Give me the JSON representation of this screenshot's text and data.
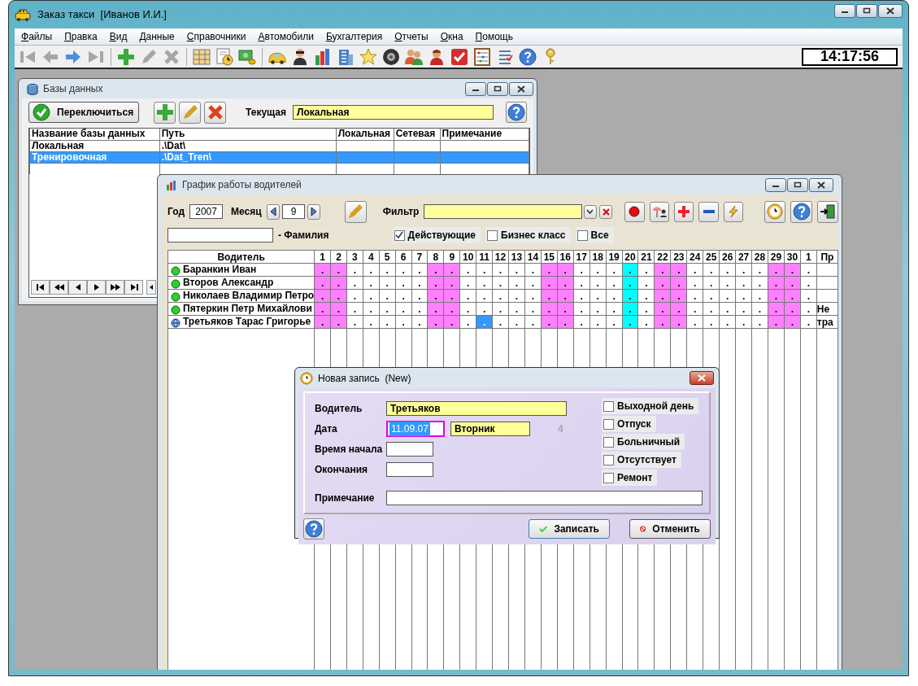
{
  "window": {
    "title": "Заказ такси  [Иванов И.И.]"
  },
  "menu": [
    "Файлы",
    "Правка",
    "Вид",
    "Данные",
    "Справочники",
    "Автомобили",
    "Бухгалтерия",
    "Отчеты",
    "Окна",
    "Помощь"
  ],
  "toolbar": [
    {
      "kind": "first",
      "disabled": true
    },
    {
      "kind": "back",
      "disabled": true
    },
    {
      "kind": "forward",
      "disabled": false
    },
    {
      "kind": "last",
      "disabled": true
    },
    {
      "kind": "add",
      "disabled": false
    },
    {
      "kind": "edit",
      "disabled": true
    },
    {
      "kind": "delete",
      "disabled": true
    },
    {
      "kind": "table",
      "disabled": false
    },
    {
      "kind": "schedule",
      "disabled": false
    },
    {
      "kind": "money",
      "disabled": false
    },
    {
      "kind": "car",
      "disabled": false
    },
    {
      "kind": "person",
      "disabled": false
    },
    {
      "kind": "chart",
      "disabled": false
    },
    {
      "kind": "building",
      "disabled": false
    },
    {
      "kind": "star",
      "disabled": false
    },
    {
      "kind": "tire",
      "disabled": false
    },
    {
      "kind": "people",
      "disabled": false
    },
    {
      "kind": "person2",
      "disabled": false
    },
    {
      "kind": "check",
      "disabled": false
    },
    {
      "kind": "abacus",
      "disabled": false
    },
    {
      "kind": "list",
      "disabled": false
    },
    {
      "kind": "help",
      "disabled": false
    },
    {
      "kind": "key",
      "disabled": false
    }
  ],
  "clock": "14:17:56",
  "databases_window": {
    "title": "Базы данных",
    "switch_button": "Переключиться",
    "current_label": "Текущая",
    "current_value": "Локальная",
    "table": {
      "columns": [
        "Название базы данных",
        "Путь",
        "Локальная",
        "Сетевая",
        "Примечание"
      ],
      "rows": [
        {
          "cells": [
            "Локальная",
            ".\\Dat\\"
          ],
          "selected": false
        },
        {
          "cells": [
            "Тренировочная",
            ".\\Dat_Tren\\"
          ],
          "selected": true
        }
      ]
    }
  },
  "schedule_window": {
    "title": "График работы водителей",
    "year_label": "Год",
    "year": "2007",
    "month_label": "Месяц",
    "month": "9",
    "filter_label": "Фильтр",
    "surname_label": "- Фамилия",
    "checkboxes": [
      {
        "label": "Действующие",
        "checked": true
      },
      {
        "label": "Бизнес класс",
        "checked": false
      },
      {
        "label": "Все",
        "checked": false
      }
    ],
    "grid": {
      "driver_column": "Водитель",
      "note_column": "Пр",
      "day_columns": [
        {
          "label": "1",
          "kind": "weekend"
        },
        {
          "label": "2",
          "kind": "weekend"
        },
        {
          "label": "3",
          "kind": "workday"
        },
        {
          "label": "4",
          "kind": "workday"
        },
        {
          "label": "5",
          "kind": "workday"
        },
        {
          "label": "6",
          "kind": "workday"
        },
        {
          "label": "7",
          "kind": "workday"
        },
        {
          "label": "8",
          "kind": "weekend"
        },
        {
          "label": "9",
          "kind": "weekend"
        },
        {
          "label": "10",
          "kind": "workday"
        },
        {
          "label": "11",
          "kind": "workday"
        },
        {
          "label": "12",
          "kind": "workday"
        },
        {
          "label": "13",
          "kind": "workday"
        },
        {
          "label": "14",
          "kind": "workday"
        },
        {
          "label": "15",
          "kind": "weekend"
        },
        {
          "label": "16",
          "kind": "weekend"
        },
        {
          "label": "17",
          "kind": "workday"
        },
        {
          "label": "18",
          "kind": "workday"
        },
        {
          "label": "19",
          "kind": "workday"
        },
        {
          "label": "20",
          "kind": "holiday"
        },
        {
          "label": "21",
          "kind": "workday"
        },
        {
          "label": "22",
          "kind": "weekend"
        },
        {
          "label": "23",
          "kind": "weekend"
        },
        {
          "label": "24",
          "kind": "workday"
        },
        {
          "label": "25",
          "kind": "workday"
        },
        {
          "label": "26",
          "kind": "workday"
        },
        {
          "label": "27",
          "kind": "workday"
        },
        {
          "label": "28",
          "kind": "workday"
        },
        {
          "label": "29",
          "kind": "weekend"
        },
        {
          "label": "30",
          "kind": "weekend"
        },
        {
          "label": "1",
          "kind": "workday"
        }
      ],
      "rows": [
        {
          "driver": "Баранкин Иван",
          "kind": "active",
          "cells": [
            {
              "text": ".",
              "selected": false
            },
            {
              "text": ".",
              "selected": false
            },
            {
              "text": ".",
              "selected": false
            },
            {
              "text": ".",
              "selected": false
            },
            {
              "text": ".",
              "selected": false
            },
            {
              "text": ".",
              "selected": false
            },
            {
              "text": ".",
              "selected": false
            },
            {
              "text": ".",
              "selected": false
            },
            {
              "text": ".",
              "selected": false
            },
            {
              "text": ".",
              "selected": false
            },
            {
              "text": ".",
              "selected": false
            },
            {
              "text": ".",
              "selected": false
            },
            {
              "text": ".",
              "selected": false
            },
            {
              "text": ".",
              "selected": false
            },
            {
              "text": ".",
              "selected": false
            },
            {
              "text": ".",
              "selected": false
            },
            {
              "text": ".",
              "selected": false
            },
            {
              "text": ".",
              "selected": false
            },
            {
              "text": ".",
              "selected": false
            },
            {
              "text": ".",
              "selected": false
            },
            {
              "text": ".",
              "selected": false
            },
            {
              "text": ".",
              "selected": false
            },
            {
              "text": ".",
              "selected": false
            },
            {
              "text": ".",
              "selected": false
            },
            {
              "text": ".",
              "selected": false
            },
            {
              "text": ".",
              "selected": false
            },
            {
              "text": ".",
              "selected": false
            },
            {
              "text": ".",
              "selected": false
            },
            {
              "text": ".",
              "selected": false
            },
            {
              "text": ".",
              "selected": false
            },
            {
              "text": ".",
              "selected": false
            }
          ]
        },
        {
          "driver": "Второв Александр",
          "kind": "active",
          "cells": [
            {
              "text": ".",
              "selected": false
            },
            {
              "text": ".",
              "selected": false
            },
            {
              "text": ".",
              "selected": false
            },
            {
              "text": ".",
              "selected": false
            },
            {
              "text": ".",
              "selected": false
            },
            {
              "text": ".",
              "selected": false
            },
            {
              "text": ".",
              "selected": false
            },
            {
              "text": ".",
              "selected": false
            },
            {
              "text": ".",
              "selected": false
            },
            {
              "text": ".",
              "selected": false
            },
            {
              "text": ".",
              "selected": false
            },
            {
              "text": ".",
              "selected": false
            },
            {
              "text": ".",
              "selected": false
            },
            {
              "text": ".",
              "selected": false
            },
            {
              "text": ".",
              "selected": false
            },
            {
              "text": ".",
              "selected": false
            },
            {
              "text": ".",
              "selected": false
            },
            {
              "text": ".",
              "selected": false
            },
            {
              "text": ".",
              "selected": false
            },
            {
              "text": ".",
              "selected": false
            },
            {
              "text": ".",
              "selected": false
            },
            {
              "text": ".",
              "selected": false
            },
            {
              "text": ".",
              "selected": false
            },
            {
              "text": ".",
              "selected": false
            },
            {
              "text": ".",
              "selected": false
            },
            {
              "text": ".",
              "selected": false
            },
            {
              "text": ".",
              "selected": false
            },
            {
              "text": ".",
              "selected": false
            },
            {
              "text": ".",
              "selected": false
            },
            {
              "text": ".",
              "selected": false
            },
            {
              "text": ".",
              "selected": false
            }
          ]
        },
        {
          "driver": "Николаев Владимир Петро",
          "kind": "active",
          "cells": [
            {
              "text": ".",
              "selected": false
            },
            {
              "text": ".",
              "selected": false
            },
            {
              "text": ".",
              "selected": false
            },
            {
              "text": ".",
              "selected": false
            },
            {
              "text": ".",
              "selected": false
            },
            {
              "text": ".",
              "selected": false
            },
            {
              "text": ".",
              "selected": false
            },
            {
              "text": ".",
              "selected": false
            },
            {
              "text": ".",
              "selected": false
            },
            {
              "text": ".",
              "selected": false
            },
            {
              "text": ".",
              "selected": false
            },
            {
              "text": ".",
              "selected": false
            },
            {
              "text": ".",
              "selected": false
            },
            {
              "text": ".",
              "selected": false
            },
            {
              "text": ".",
              "selected": false
            },
            {
              "text": ".",
              "selected": false
            },
            {
              "text": ".",
              "selected": false
            },
            {
              "text": ".",
              "selected": false
            },
            {
              "text": ".",
              "selected": false
            },
            {
              "text": ".",
              "selected": false
            },
            {
              "text": ".",
              "selected": false
            },
            {
              "text": ".",
              "selected": false
            },
            {
              "text": ".",
              "selected": false
            },
            {
              "text": ".",
              "selected": false
            },
            {
              "text": ".",
              "selected": false
            },
            {
              "text": ".",
              "selected": false
            },
            {
              "text": ".",
              "selected": false
            },
            {
              "text": ".",
              "selected": false
            },
            {
              "text": ".",
              "selected": false
            },
            {
              "text": ".",
              "selected": false
            },
            {
              "text": ".",
              "selected": false
            }
          ]
        },
        {
          "driver": "Пятеркин Петр Михайлови",
          "kind": "active",
          "note": "Не",
          "cells": [
            {
              "text": ".",
              "selected": false
            },
            {
              "text": ".",
              "selected": false
            },
            {
              "text": ".",
              "selected": false
            },
            {
              "text": ".",
              "selected": false
            },
            {
              "text": ".",
              "selected": false
            },
            {
              "text": ".",
              "selected": false
            },
            {
              "text": ".",
              "selected": false
            },
            {
              "text": ".",
              "selected": false
            },
            {
              "text": ".",
              "selected": false
            },
            {
              "text": ".",
              "selected": false
            },
            {
              "text": ".",
              "selected": false
            },
            {
              "text": ".",
              "selected": false
            },
            {
              "text": ".",
              "selected": false
            },
            {
              "text": ".",
              "selected": false
            },
            {
              "text": ".",
              "selected": false
            },
            {
              "text": ".",
              "selected": false
            },
            {
              "text": ".",
              "selected": false
            },
            {
              "text": ".",
              "selected": false
            },
            {
              "text": ".",
              "selected": false
            },
            {
              "text": ".",
              "selected": false
            },
            {
              "text": ".",
              "selected": false
            },
            {
              "text": ".",
              "selected": false
            },
            {
              "text": ".",
              "selected": false
            },
            {
              "text": ".",
              "selected": false
            },
            {
              "text": ".",
              "selected": false
            },
            {
              "text": ".",
              "selected": false
            },
            {
              "text": ".",
              "selected": false
            },
            {
              "text": ".",
              "selected": false
            },
            {
              "text": ".",
              "selected": false
            },
            {
              "text": ".",
              "selected": false
            },
            {
              "text": ".",
              "selected": false
            }
          ]
        },
        {
          "driver": "Третьяков Тарас Григорье",
          "kind": "online",
          "note": "тра",
          "cells": [
            {
              "text": ".",
              "selected": false
            },
            {
              "text": ".",
              "selected": false
            },
            {
              "text": ".",
              "selected": false
            },
            {
              "text": ".",
              "selected": false
            },
            {
              "text": ".",
              "selected": false
            },
            {
              "text": ".",
              "selected": false
            },
            {
              "text": ".",
              "selected": false
            },
            {
              "text": ".",
              "selected": false
            },
            {
              "text": ".",
              "selected": false
            },
            {
              "text": ".",
              "selected": false
            },
            {
              "text": ".",
              "selected": true
            },
            {
              "text": ".",
              "selected": false
            },
            {
              "text": ".",
              "selected": false
            },
            {
              "text": ".",
              "selected": false
            },
            {
              "text": ".",
              "selected": false
            },
            {
              "text": ".",
              "selected": false
            },
            {
              "text": ".",
              "selected": false
            },
            {
              "text": ".",
              "selected": false
            },
            {
              "text": ".",
              "selected": false
            },
            {
              "text": ".",
              "selected": false
            },
            {
              "text": ".",
              "selected": false
            },
            {
              "text": ".",
              "selected": false
            },
            {
              "text": ".",
              "selected": false
            },
            {
              "text": ".",
              "selected": false
            },
            {
              "text": ".",
              "selected": false
            },
            {
              "text": ".",
              "selected": false
            },
            {
              "text": ".",
              "selected": false
            },
            {
              "text": ".",
              "selected": false
            },
            {
              "text": ".",
              "selected": false
            },
            {
              "text": ".",
              "selected": false
            },
            {
              "text": ".",
              "selected": false
            }
          ]
        }
      ]
    }
  },
  "dialog": {
    "title": "Новая запись  (New)",
    "driver_label": "Водитель",
    "driver_value": "Третьяков",
    "date_label": "Дата",
    "date_value": "11.09.07",
    "weekday": "Вторник",
    "day_number": "4",
    "start_label": "Время начала",
    "end_label": "Окончания",
    "note_label": "Примечание",
    "checkboxes": [
      {
        "label": "Выходной день",
        "checked": false
      },
      {
        "label": "Отпуск",
        "checked": false
      },
      {
        "label": "Больничный",
        "checked": false
      },
      {
        "label": "Отсутствует",
        "checked": false
      },
      {
        "label": "Ремонт",
        "checked": false
      }
    ],
    "save_button": "Записать",
    "cancel_button": "Отменить"
  }
}
